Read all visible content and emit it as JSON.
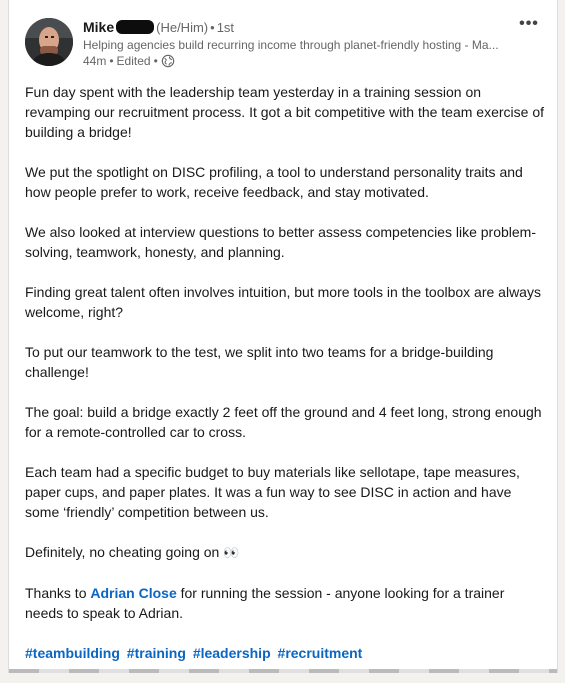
{
  "author": {
    "name": "Mike",
    "pronouns": "(He/Him)",
    "degree": "1st",
    "headline": "Helping agencies build recurring income through planet-friendly hosting - Ma...",
    "time": "44m",
    "edited": "Edited",
    "visibility_icon": "globe-icon"
  },
  "menu": {
    "more_label": "•••",
    "more_icon": "more-icon"
  },
  "post": {
    "p1": "Fun day spent with the leadership team yesterday in a training session on revamping our recruitment process. It got a bit competitive with the team exercise of building a bridge!",
    "p2": "We put the spotlight on DISC profiling, a tool to understand personality traits and how people prefer to work, receive feedback, and stay motivated.",
    "p3": "We also looked at interview questions to better assess competencies like problem-solving, teamwork, honesty, and planning.",
    "p4": "Finding great talent often involves intuition, but more tools in the toolbox are always welcome, right?",
    "p5": "To put our teamwork to the test, we split into two teams for a bridge-building challenge!",
    "p6": "The goal: build a bridge exactly 2 feet off the ground and 4 feet long, strong enough for a remote-controlled car to cross.",
    "p7": "Each team had a specific budget to buy materials like sellotape, tape measures, paper cups, and paper plates. It was a fun way to see DISC in action and have some ‘friendly’ competition between us.",
    "p8_text": "Definitely, no cheating going on ",
    "p8_emoji": "👀",
    "p9_prefix": "Thanks to ",
    "p9_mention": "Adrian Close",
    "p9_suffix": " for running the session - anyone looking for a trainer needs to speak to Adrian.",
    "hashtags": [
      "#teambuilding",
      "#training",
      "#leadership",
      "#recruitment"
    ]
  },
  "colors": {
    "link": "#0a66c2",
    "text": "#191919",
    "muted": "#666666"
  }
}
